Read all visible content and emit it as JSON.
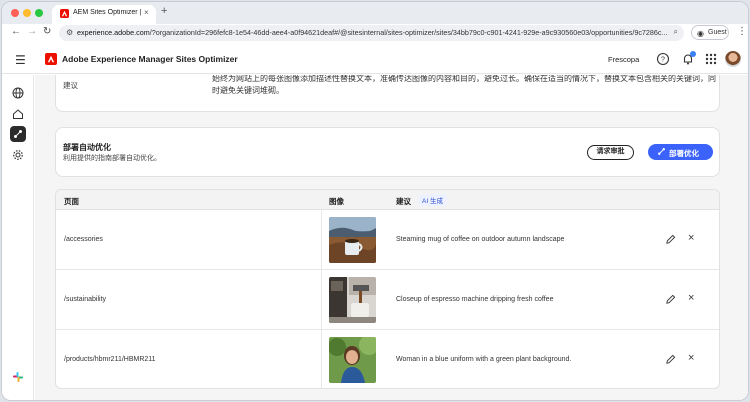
{
  "browser": {
    "tab_title": "AEM Sites Optimizer | Adobe",
    "tab_close": "×",
    "new_tab": "+",
    "url_domain": "experience.adobe.com",
    "url_path": "/?organizationId=296fefc8-1e54-46dd-aee4-a0f94621deaf#/@sitesinternal/sites-optimizer/sites/34bb79c0-c901-4241-929e-a9c930560e03/opportunities/9c7286c...",
    "guest_label": "Guest"
  },
  "header": {
    "app_title": "Adobe Experience Manager Sites Optimizer",
    "org_name": "Frescopa"
  },
  "suggestion_card": {
    "label": "建议",
    "text": "始终为网站上的每张图像添加描述性替换文本，准确传达图像的内容和目的，避免过长。确保在适当的情况下，替换文本包含相关的关键词，同时避免关键词堆砌。"
  },
  "deploy_card": {
    "title": "部署自动优化",
    "subtitle": "利用提供的指南部署自动优化。",
    "review_button": "请求审批",
    "deploy_button": "部署优化"
  },
  "table": {
    "headers": {
      "page": "页面",
      "image": "图像",
      "suggestion": "建议",
      "ai_badge": "AI 生成"
    },
    "rows": [
      {
        "page": "/accessories",
        "image": "coffee-mug-autumn-photo",
        "suggestion": "Steaming mug of coffee on outdoor autumn landscape"
      },
      {
        "page": "/sustainability",
        "image": "espresso-machine-photo",
        "suggestion": "Closeup of espresso machine dripping fresh coffee"
      },
      {
        "page": "/products/hbmr211/HBMR211",
        "image": "woman-blue-uniform-photo",
        "suggestion": "Woman in a blue uniform with a green plant background."
      }
    ],
    "row_actions": {
      "edit": "pencil-icon",
      "dismiss": "×"
    }
  },
  "colors": {
    "accent": "#3b63fb",
    "adobe_red": "#eb1000"
  }
}
